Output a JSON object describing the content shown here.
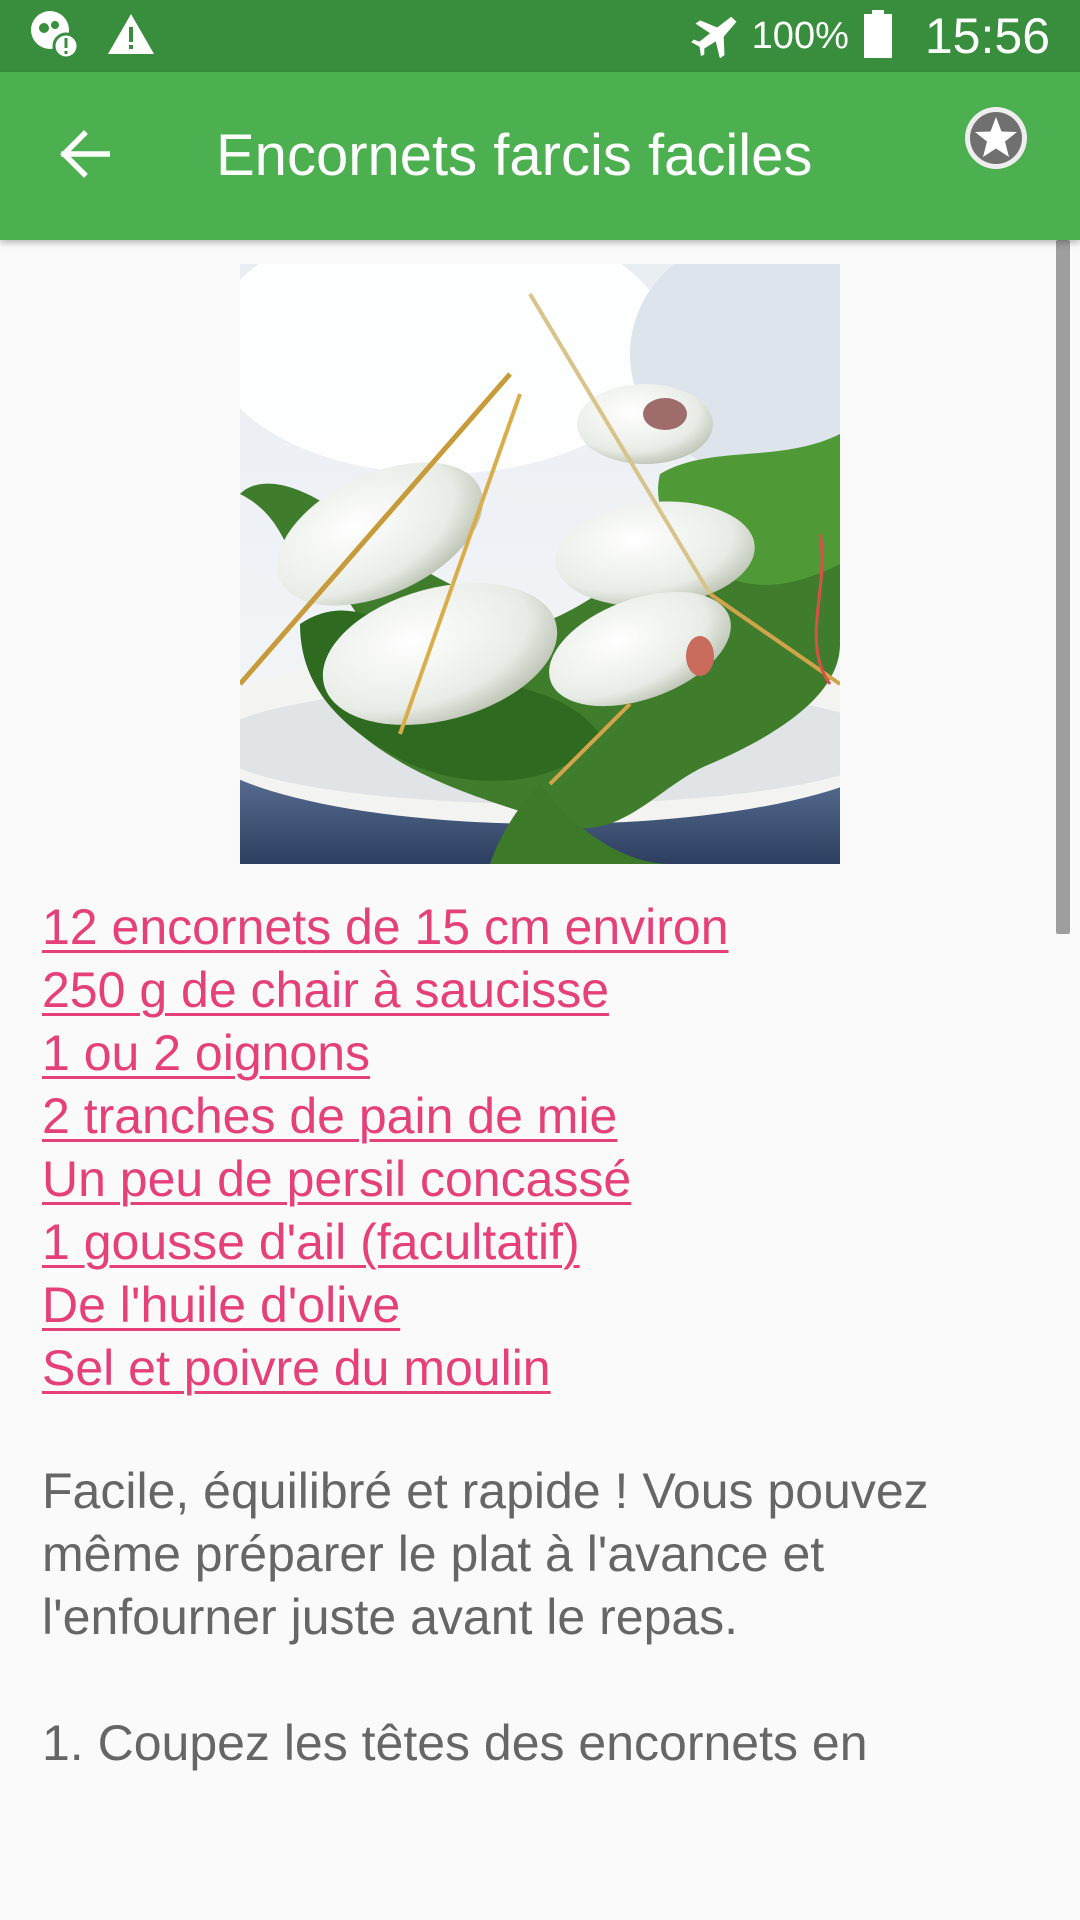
{
  "status_bar": {
    "battery_text": "100%",
    "time": "15:56",
    "icons": [
      "data-saver-warning-icon",
      "warning-icon",
      "airplane-mode-icon",
      "battery-icon"
    ]
  },
  "app_bar": {
    "title": "Encornets farcis faciles",
    "back_icon": "arrow-back-icon",
    "favorite_icon": "star-icon",
    "background_color": "#4caf50",
    "status_color": "#388e3c"
  },
  "recipe": {
    "image_subject": "stuffed-squid-dish-image",
    "ingredients": [
      "12 encornets de 15 cm environ",
      "250 g de chair à saucisse",
      "1 ou 2 oignons",
      "2 tranches de pain de mie",
      "Un peu de persil concassé",
      "1 gousse d'ail (facultatif)",
      "De l'huile d'olive",
      "Sel et poivre du moulin"
    ],
    "ingredient_color": "#e5407a",
    "description": "Facile, équilibré et rapide ! Vous pouvez même préparer le plat à l'avance et l'enfourner juste avant le repas.",
    "step_1": "1. Coupez les têtes des encornets en"
  }
}
